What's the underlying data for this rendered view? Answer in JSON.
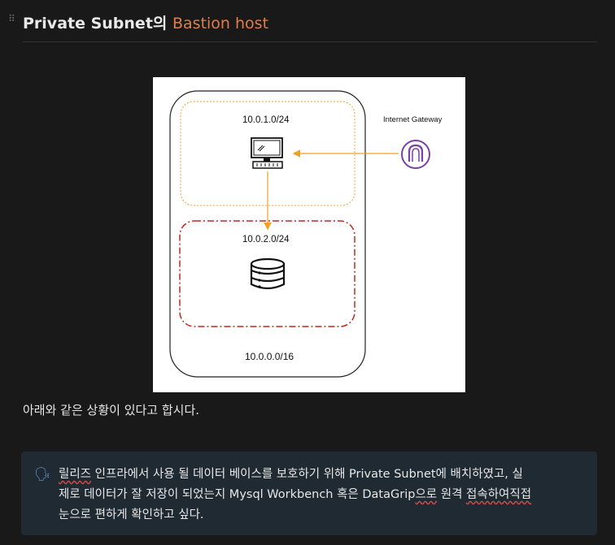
{
  "heading": {
    "prefix": "Private Subnet의 ",
    "accent": "Bastion host"
  },
  "diagram": {
    "internet_gateway_label": "Internet Gateway",
    "public_subnet_cidr": "10.0.1.0/24",
    "private_subnet_cidr": "10.0.2.0/24",
    "vpc_cidr": "10.0.0.0/16",
    "colors": {
      "public_subnet": "#f0a020",
      "private_subnet": "#c0281e",
      "gateway": "#7b3fa8",
      "arrow": "#f0a020"
    }
  },
  "paragraph": "아래와 같은 상황이 있다고 합시다.",
  "callout": {
    "icon": "speaking-head-icon",
    "word_release": "릴리즈",
    "text_1": " 인프라에서 사용 될 데이터 베이스를 보호하기 위해 Private Subnet에 배치하였고, 실",
    "text_2": "제로 데이터가 잘 저장이 되었는지 Mysql Workbench 혹은 DataGrip",
    "word_euro": "으로",
    "text_3": " 원격 ",
    "word_direct": "접속하여직접",
    "text_4": "눈으로 편하게 확인하고 싶다."
  }
}
